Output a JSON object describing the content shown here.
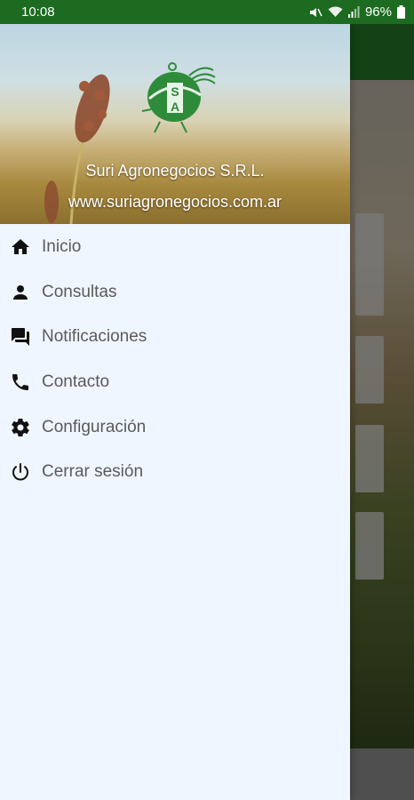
{
  "status_bar": {
    "time": "10:08",
    "battery": "96%",
    "icons": [
      "mute-icon",
      "wifi-icon",
      "signal-icon",
      "battery-icon"
    ]
  },
  "drawer": {
    "company_name": "Suri Agronegocios S.R.L.",
    "company_url": "www.suriagronegocios.com.ar",
    "logo_letters": [
      "S",
      "A"
    ],
    "items": [
      {
        "label": "Inicio",
        "icon": "home-icon"
      },
      {
        "label": "Consultas",
        "icon": "person-icon"
      },
      {
        "label": "Notificaciones",
        "icon": "chat-icon"
      },
      {
        "label": "Contacto",
        "icon": "phone-icon"
      },
      {
        "label": "Configuración",
        "icon": "settings-icon"
      },
      {
        "label": "Cerrar sesión",
        "icon": "power-icon"
      }
    ]
  },
  "colors": {
    "status_bar": "#1c6b20",
    "app_bar": "#1d5a1f",
    "drawer_bg": "#f0f6ff",
    "menu_text": "#5a5a5a",
    "logo_green": "#2e8b3a"
  }
}
